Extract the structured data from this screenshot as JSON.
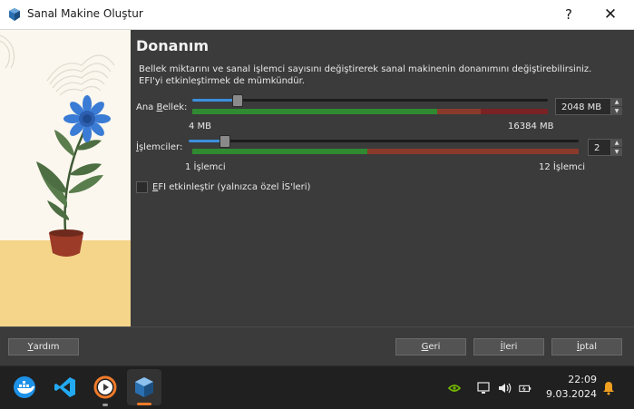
{
  "window": {
    "title": "Sanal Makine Oluştur",
    "help_label": "?",
    "close_label": "✕"
  },
  "page": {
    "heading": "Donanım",
    "description_line1": "Bellek miktarını ve sanal işlemci sayısını değiştirerek sanal makinenin donanımını değiştirebilirsiniz.",
    "description_line2": "EFI'yi etkinleştirmek de mümkündür."
  },
  "memory": {
    "label_pre": "Ana ",
    "label_u": "B",
    "label_post": "ellek:",
    "value": "2048 MB",
    "min_label": "4 MB",
    "max_label": "16384 MB",
    "level": 0.125
  },
  "cpu": {
    "label_u": "İ",
    "label_post": "şlemciler:",
    "value": "2",
    "min_label": "1 İşlemci",
    "max_label": "12 İşlemci",
    "level": 0.09
  },
  "efi": {
    "label_u": "E",
    "label_post": "FI etkinleştir (yalnızca özel İS'leri)",
    "checked": false
  },
  "buttons": {
    "help_u": "Y",
    "help_post": "ardım",
    "back_u": "G",
    "back_post": "eri",
    "next_u": "İ",
    "next_post": "leri",
    "cancel_u": "İ",
    "cancel_post": "ptal"
  },
  "taskbar": {
    "apps": [
      "docker-icon",
      "vscode-icon",
      "media-player-icon",
      "virtualbox-icon"
    ],
    "time": "22:09",
    "date": "9.03.2024"
  }
}
